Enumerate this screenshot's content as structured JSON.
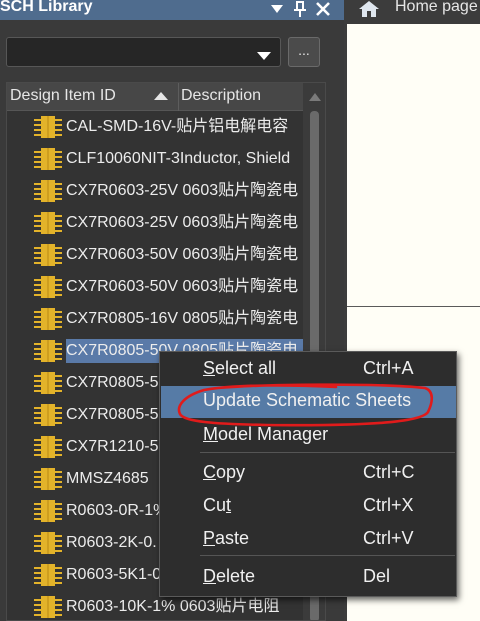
{
  "panel": {
    "title": "SCH Library",
    "header_icons": [
      "triangle-down-icon",
      "pin-icon",
      "close-icon"
    ],
    "more_button_label": "...",
    "columns": {
      "id": "Design Item ID",
      "description": "Description"
    },
    "rows": [
      {
        "text": "CAL-SMD-16V-贴片铝电解电容",
        "selected": false
      },
      {
        "text": "CLF10060NIT-3Inductor, Shield",
        "selected": false
      },
      {
        "text": "CX7R0603-25V 0603贴片陶瓷电",
        "selected": false
      },
      {
        "text": "CX7R0603-25V 0603贴片陶瓷电",
        "selected": false
      },
      {
        "text": "CX7R0603-50V 0603贴片陶瓷电",
        "selected": false
      },
      {
        "text": "CX7R0603-50V 0603贴片陶瓷电",
        "selected": false
      },
      {
        "text": "CX7R0805-16V 0805贴片陶瓷电",
        "selected": false
      },
      {
        "text": "CX7R0805-50V 0805贴片陶瓷电",
        "selected": true
      },
      {
        "text": "CX7R0805-5",
        "selected": false
      },
      {
        "text": "CX7R0805-5",
        "selected": false
      },
      {
        "text": "CX7R1210-5",
        "selected": false
      },
      {
        "text": "MMSZ4685",
        "selected": false
      },
      {
        "text": "R0603-0R-1%",
        "selected": false
      },
      {
        "text": "R0603-2K-0.",
        "selected": false
      },
      {
        "text": "R0603-5K1-0",
        "selected": false
      },
      {
        "text": "R0603-10K-1% 0603贴片电阻",
        "selected": false
      }
    ]
  },
  "tab": {
    "label": "Home page"
  },
  "context_menu": {
    "items": [
      {
        "pre": "",
        "key": "S",
        "post": "elect all",
        "shortcut": "Ctrl+A",
        "highlighted": false
      },
      {
        "pre": "",
        "key": "",
        "post": "Update Schematic Sheets",
        "shortcut": "",
        "highlighted": true
      },
      {
        "pre": "",
        "key": "M",
        "post": "odel Manager",
        "shortcut": "",
        "highlighted": false
      },
      {
        "pre": "",
        "key": "C",
        "post": "opy",
        "shortcut": "Ctrl+C",
        "highlighted": false
      },
      {
        "pre": "Cu",
        "key": "t",
        "post": "",
        "shortcut": "Ctrl+X",
        "highlighted": false
      },
      {
        "pre": "",
        "key": "P",
        "post": "aste",
        "shortcut": "Ctrl+V",
        "highlighted": false
      },
      {
        "pre": "",
        "key": "D",
        "post": "elete",
        "shortcut": "Del",
        "highlighted": false
      }
    ]
  },
  "colors": {
    "header_bar": "#4f6c8e",
    "selection": "#5a7aa8",
    "menu_highlight": "#567ba6",
    "annotation": "#e01b1b",
    "component_icon": "#e3b32a"
  }
}
